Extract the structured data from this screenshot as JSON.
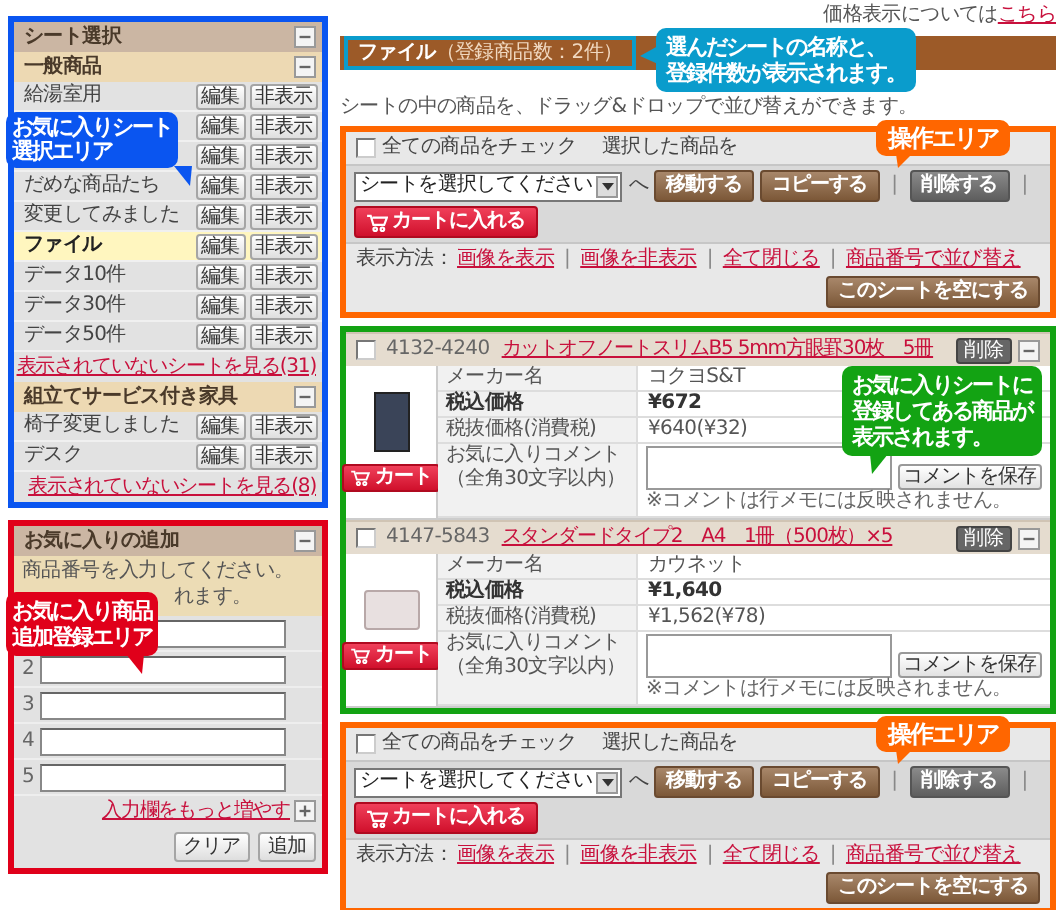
{
  "price_note": {
    "text": "価格表示については",
    "link": "こちら"
  },
  "sheet_panel": {
    "title": "シート選択",
    "expanded": true,
    "callout": {
      "lines": [
        "お気に入りシート",
        "選択エリア"
      ],
      "color": "#0a55f0"
    },
    "groups": [
      {
        "name": "一般商品",
        "expanded": true,
        "sheets": [
          {
            "label": "給湯室用",
            "selected": false,
            "buttons": [
              "編集",
              "非表示"
            ]
          },
          {
            "selected": false,
            "buttons": [
              "編集",
              "非表示"
            ]
          },
          {
            "selected": false,
            "buttons": [
              "編集",
              "非表示"
            ]
          },
          {
            "label": "だめな商品たち",
            "selected": false,
            "buttons": [
              "編集",
              "非表示"
            ]
          },
          {
            "label": "変更してみました",
            "selected": false,
            "buttons": [
              "編集",
              "非表示"
            ]
          },
          {
            "label": "ファイル",
            "selected": true,
            "buttons": [
              "編集",
              "非表示"
            ]
          },
          {
            "label": "データ10件",
            "selected": false,
            "buttons": [
              "編集",
              "非表示"
            ]
          },
          {
            "label": "データ30件",
            "selected": false,
            "buttons": [
              "編集",
              "非表示"
            ]
          },
          {
            "label": "データ50件",
            "selected": false,
            "buttons": [
              "編集",
              "非表示"
            ]
          }
        ],
        "more_link": "表示されていないシートを見る(31)"
      },
      {
        "name": "組立てサービス付き家具",
        "expanded": true,
        "sheets": [
          {
            "label": "椅子変更しました",
            "selected": false,
            "buttons": [
              "編集",
              "非表示"
            ]
          },
          {
            "label": "デスク",
            "selected": false,
            "buttons": [
              "編集",
              "非表示"
            ]
          }
        ],
        "more_link": "表示されていないシートを見る(8)"
      }
    ]
  },
  "add_panel": {
    "title": "お気に入りの追加",
    "expanded": true,
    "callout": {
      "lines": [
        "お気に入り商品",
        "追加登録エリア"
      ],
      "color": "#e0001a"
    },
    "instructions": [
      "商品番号を入力してください。",
      "れます。"
    ],
    "fields": [
      {
        "kind": "field"
      },
      {
        "kind": "field",
        "number": "2"
      },
      {
        "kind": "field",
        "number": "3"
      },
      {
        "kind": "field",
        "number": "4"
      },
      {
        "kind": "field",
        "number": "5"
      }
    ],
    "more_link": "入力欄をもっと増やす",
    "buttons": [
      "クリア",
      "追加"
    ]
  },
  "sheet_header": {
    "title": "ファイル",
    "count": "（登録商品数：2件）",
    "callout": {
      "lines": [
        "選んだシートの名称と、",
        "登録件数が表示されます。"
      ],
      "color": "#0a9ccc"
    }
  },
  "hint": "シートの中の商品を、ドラッグ&ドロップで並び替えができます。",
  "toolbars": [
    {
      "check_all": {
        "label": "全ての商品をチェック",
        "checked": false
      },
      "selected_label": "選択した商品を",
      "select": "シートを選択してください",
      "to": "へ",
      "actions": [
        {
          "kind": "normal",
          "label": "移動する"
        },
        {
          "kind": "normal",
          "label": "コピーする"
        },
        {
          "kind": "separator",
          "label": "|"
        },
        {
          "kind": "delete",
          "label": "削除する"
        },
        {
          "kind": "separator",
          "label": "|"
        },
        {
          "kind": "cart",
          "label": "カートに入れる"
        }
      ],
      "view_label": "表示方法：",
      "view_items": [
        {
          "kind": "link",
          "label": "画像を表示"
        },
        {
          "kind": "separator",
          "label": "|"
        },
        {
          "kind": "link",
          "label": "画像を非表示"
        },
        {
          "kind": "separator",
          "label": "|"
        },
        {
          "kind": "link",
          "label": "全て閉じる"
        },
        {
          "kind": "separator",
          "label": "|"
        },
        {
          "kind": "link",
          "label": "商品番号で並び替え"
        }
      ],
      "empty_button": "このシートを空にする",
      "callout": {
        "lines": [
          "操作エリア"
        ],
        "color": "#ff6600"
      }
    },
    {
      "check_all": {
        "label": "全ての商品をチェック",
        "checked": false
      },
      "selected_label": "選択した商品を",
      "select": "シートを選択してください",
      "to": "へ",
      "actions": [
        {
          "kind": "normal",
          "label": "移動する"
        },
        {
          "kind": "normal",
          "label": "コピーする"
        },
        {
          "kind": "separator",
          "label": "|"
        },
        {
          "kind": "delete",
          "label": "削除する"
        },
        {
          "kind": "separator",
          "label": "|"
        },
        {
          "kind": "cart",
          "label": "カートに入れる"
        }
      ],
      "view_label": "表示方法：",
      "view_items": [
        {
          "kind": "link",
          "label": "画像を表示"
        },
        {
          "kind": "separator",
          "label": "|"
        },
        {
          "kind": "link",
          "label": "画像を非表示"
        },
        {
          "kind": "separator",
          "label": "|"
        },
        {
          "kind": "link",
          "label": "全て閉じる"
        },
        {
          "kind": "separator",
          "label": "|"
        },
        {
          "kind": "link",
          "label": "商品番号で並び替え"
        }
      ],
      "empty_button": "このシートを空にする",
      "callout": {
        "lines": [
          "操作エリア"
        ],
        "color": "#ff6600"
      }
    }
  ],
  "products": {
    "callout": {
      "lines": [
        "お気に入りシートに",
        "登録してある商品が",
        "表示されます。"
      ],
      "color": "#13a313"
    },
    "items": [
      {
        "checked": false,
        "code": "4132-4240",
        "name": "カットオフノートスリムB5 5mm方眼罫30枚　5冊",
        "delete": "削除",
        "expanded": true,
        "image": {
          "kind": "notebook"
        },
        "cart": "カート",
        "rows": [
          {
            "kind": "plain",
            "label": "メーカー名",
            "value": "コクヨS&T"
          },
          {
            "kind": "price",
            "label": "税込価格",
            "value": "¥672"
          },
          {
            "kind": "plain",
            "label": "税抜価格(消費税)",
            "value": "¥640(¥32)"
          },
          {
            "kind": "comment",
            "label": "お気に入りコメント（全角30文字以内）",
            "note": "※コメントは行メモには反映されません。",
            "button": "コメントを保存"
          }
        ]
      },
      {
        "checked": false,
        "code": "4147-5843",
        "name": "スタンダードタイプ2　A4　1冊（500枚）×5",
        "delete": "削除",
        "expanded": true,
        "image": {
          "kind": "paper_stack"
        },
        "cart": "カート",
        "rows": [
          {
            "kind": "plain",
            "label": "メーカー名",
            "value": "カウネット"
          },
          {
            "kind": "price",
            "label": "税込価格",
            "value": "¥1,640"
          },
          {
            "kind": "plain",
            "label": "税抜価格(消費税)",
            "value": "¥1,562(¥78)"
          },
          {
            "kind": "comment",
            "label": "お気に入りコメント（全角30文字以内）",
            "note": "※コメントは行メモには反映されません。",
            "button": "コメントを保存"
          }
        ]
      }
    ]
  }
}
